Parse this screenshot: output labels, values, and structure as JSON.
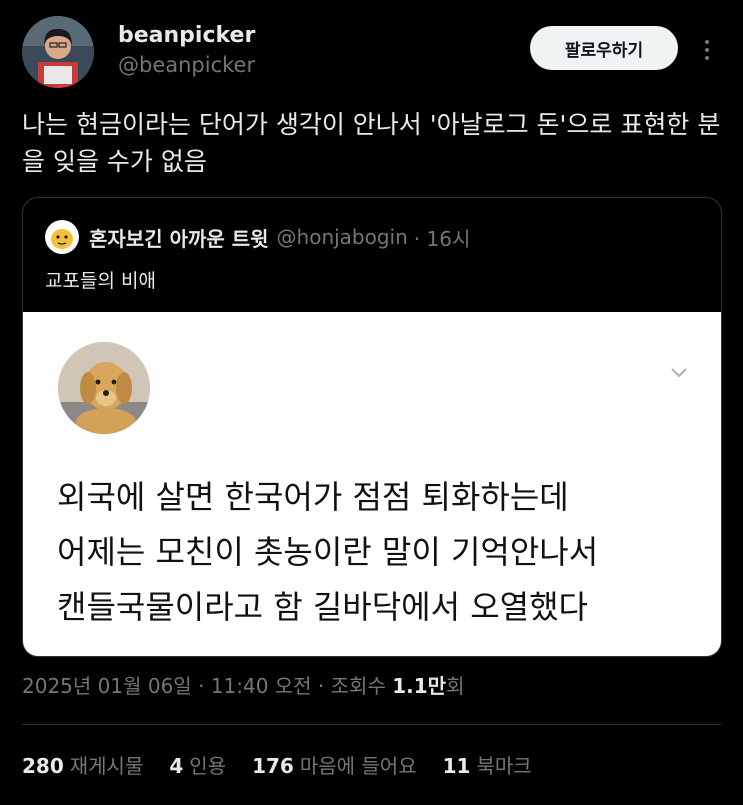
{
  "author": {
    "display_name": "beanpicker",
    "handle": "@beanpicker",
    "follow_label": "팔로우하기"
  },
  "tweet_text": "나는 현금이라는 단어가 생각이 안나서 '아날로그 돈'으로 표현한 분을 잊을 수가 없음",
  "quote": {
    "display_name": "혼자보긴 아까운 트윗",
    "handle": "@honjabogin",
    "time": "· 16시",
    "text": "교포들의 비애",
    "image_lines": [
      "외국에 살면 한국어가 점점 퇴화하는데",
      "어제는 모친이 촛농이란 말이 기억안나서",
      "캔들국물이라고 함 길바닥에서 오열했다"
    ]
  },
  "timestamp": {
    "prefix": "2025년 01월 06일 · 11:40 오전 · 조회수 ",
    "views": "1.1만",
    "suffix": "회"
  },
  "stats": {
    "retweets": "280",
    "retweets_label": "재게시물",
    "quotes": "4",
    "quotes_label": "인용",
    "likes": "176",
    "likes_label": "마음에 들어요",
    "bookmarks": "11",
    "bookmarks_label": "북마크"
  }
}
